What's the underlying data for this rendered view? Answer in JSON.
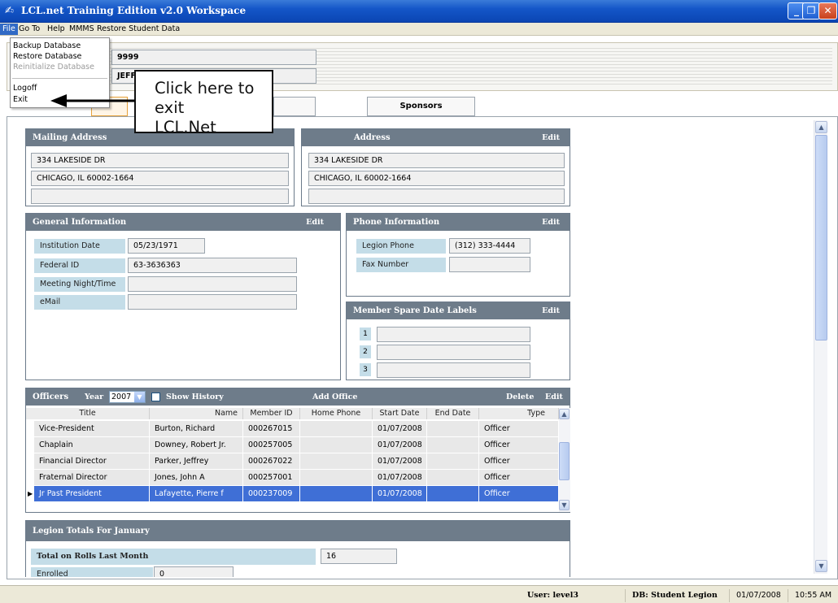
{
  "window": {
    "title": "LCL.net Training Edition v2.0 Workspace",
    "app_icon": "lcl-app-icon",
    "min_glyph": "_",
    "max_glyph": "❐",
    "close_glyph": "✕"
  },
  "menubar": {
    "items": [
      "File",
      "Go To",
      "Help",
      "MMMS",
      "Restore Student Data"
    ]
  },
  "file_menu": {
    "items": [
      {
        "label": "Backup Database",
        "disabled": false
      },
      {
        "label": "Restore Database",
        "disabled": false
      },
      {
        "label": "Reinitialize Database",
        "disabled": true
      },
      {
        "label": "Logoff",
        "disabled": false
      },
      {
        "label": "Exit",
        "disabled": false
      }
    ]
  },
  "header": {
    "legion_number": "9999",
    "legion_name": "JEFF"
  },
  "callout": {
    "line1": "Click here to exit",
    "line2": "LCL.Net"
  },
  "tabs": {
    "sponsors": "Sponsors"
  },
  "mailing_address": {
    "title": "Mailing Address",
    "line1": "334 LAKESIDE DR",
    "line2": "CHICAGO, IL 60002-1664",
    "line3": ""
  },
  "physical_address": {
    "title": "Address",
    "edit": "Edit",
    "line1": "334 LAKESIDE DR",
    "line2": "CHICAGO, IL 60002-1664",
    "line3": ""
  },
  "general_info": {
    "title": "General Information",
    "edit": "Edit",
    "institution_date_label": "Institution Date",
    "institution_date": "05/23/1971",
    "federal_id_label": "Federal ID",
    "federal_id": "63-3636363",
    "meeting_label": "Meeting Night/Time",
    "meeting": "",
    "email_label": "eMail",
    "email": ""
  },
  "phone_info": {
    "title": "Phone Information",
    "edit": "Edit",
    "legion_phone_label": "Legion Phone",
    "legion_phone": "(312) 333-4444",
    "fax_label": "Fax Number",
    "fax": ""
  },
  "spare_labels": {
    "title": "Member Spare Date Labels",
    "edit": "Edit",
    "numbers": [
      "1",
      "2",
      "3"
    ]
  },
  "officers": {
    "title": "Officers",
    "year_label": "Year",
    "year": "2007",
    "show_history": "Show History",
    "add_office": "Add Office",
    "delete": "Delete",
    "edit": "Edit",
    "columns": [
      "Title",
      "Name",
      "Member ID",
      "Home Phone",
      "Start Date",
      "End Date",
      "Type"
    ],
    "rows": [
      {
        "title": "Vice-President",
        "name": "Burton, Richard",
        "member_id": "000267015",
        "home_phone": "",
        "start_date": "01/07/2008",
        "end_date": "",
        "type": "Officer"
      },
      {
        "title": "Chaplain",
        "name": "Downey, Robert Jr.",
        "member_id": "000257005",
        "home_phone": "",
        "start_date": "01/07/2008",
        "end_date": "",
        "type": "Officer"
      },
      {
        "title": "Financial Director",
        "name": "Parker, Jeffrey",
        "member_id": "000267022",
        "home_phone": "",
        "start_date": "01/07/2008",
        "end_date": "",
        "type": "Officer"
      },
      {
        "title": "Fraternal Director",
        "name": "Jones, John A",
        "member_id": "000257001",
        "home_phone": "",
        "start_date": "01/07/2008",
        "end_date": "",
        "type": "Officer"
      },
      {
        "title": "Jr Past President",
        "name": "Lafayette, Pierre f",
        "member_id": "000237009",
        "home_phone": "",
        "start_date": "01/07/2008",
        "end_date": "",
        "type": "Officer"
      }
    ]
  },
  "totals": {
    "title": "Legion Totals For January",
    "rolls_label": "Total on Rolls Last Month",
    "rolls_value": "16",
    "enrolled_label": "Enrolled",
    "enrolled_value": "0"
  },
  "statusbar": {
    "user": "User: level3",
    "db": "DB: Student Legion",
    "date": "01/07/2008",
    "time": "10:55 AM"
  }
}
